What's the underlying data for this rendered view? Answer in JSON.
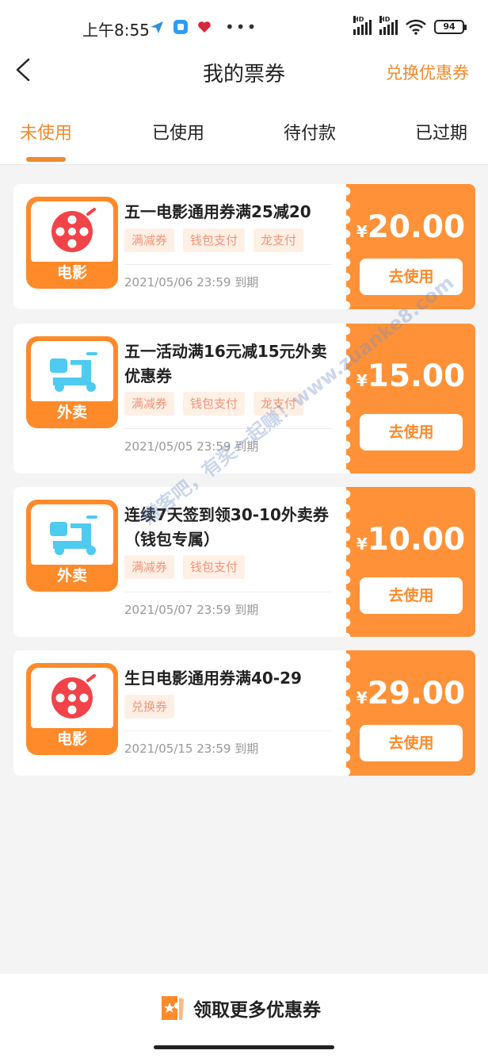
{
  "status": {
    "time": "上午8:55",
    "battery": "94",
    "signal_badge": "HD"
  },
  "header": {
    "title": "我的票券",
    "action": "兑换优惠券"
  },
  "tabs": [
    {
      "label": "未使用",
      "active": true
    },
    {
      "label": "已使用",
      "active": false
    },
    {
      "label": "待付款",
      "active": false
    },
    {
      "label": "已过期",
      "active": false
    }
  ],
  "coupons": [
    {
      "category": "电影",
      "icon": "film-reel-icon",
      "title": "五一电影通用券满25减20",
      "tags": [
        "满减券",
        "钱包支付",
        "龙支付"
      ],
      "expiry": "2021/05/06 23:59 到期",
      "currency": "¥",
      "amount": "20.00",
      "button": "去使用"
    },
    {
      "category": "外卖",
      "icon": "scooter-icon",
      "title": "五一活动满16元减15元外卖优惠券",
      "tags": [
        "满减券",
        "钱包支付",
        "龙支付"
      ],
      "expiry": "2021/05/05 23:59 到期",
      "currency": "¥",
      "amount": "15.00",
      "button": "去使用"
    },
    {
      "category": "外卖",
      "icon": "scooter-icon",
      "title": "连续7天签到领30-10外卖券（钱包专属）",
      "tags": [
        "满减券",
        "钱包支付"
      ],
      "expiry": "2021/05/07 23:59 到期",
      "currency": "¥",
      "amount": "10.00",
      "button": "去使用"
    },
    {
      "category": "电影",
      "icon": "film-reel-icon",
      "title": "生日电影通用券满40-29",
      "tags": [
        "兑换券"
      ],
      "expiry": "2021/05/15 23:59 到期",
      "currency": "¥",
      "amount": "29.00",
      "button": "去使用"
    }
  ],
  "bottom": {
    "label": "领取更多优惠券"
  },
  "watermark": "赚客吧，有奖一起赚！www.zuanke8.com",
  "colors": {
    "accent": "#f08a2c",
    "coupon_right": "#ff9238",
    "tag_bg": "#fff0e6",
    "tag_text": "#f4937a",
    "film_red": "#f2434a",
    "scooter_blue": "#4fcaf0"
  }
}
